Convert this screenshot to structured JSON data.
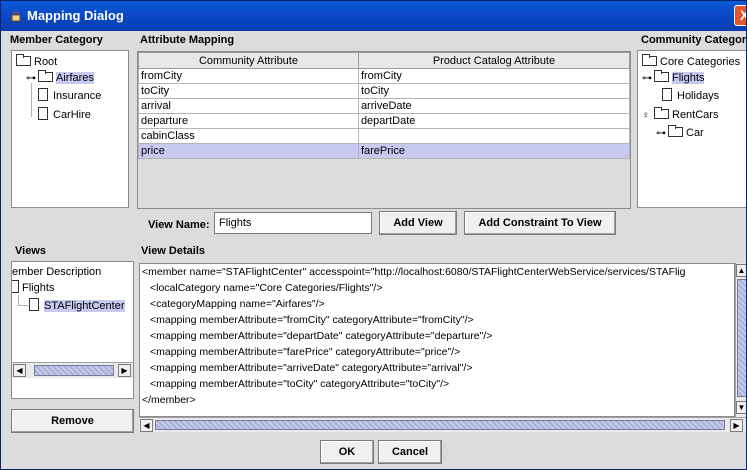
{
  "window": {
    "title": "Mapping Dialog",
    "close_label": "X"
  },
  "member_category": {
    "label": "Member Category",
    "tree": [
      {
        "label": "Root",
        "icon": "folder-icon"
      },
      {
        "label": "Airfares",
        "icon": "folder-icon",
        "selected": true
      },
      {
        "label": "Insurance",
        "icon": "document-icon"
      },
      {
        "label": "CarHire",
        "icon": "document-icon"
      }
    ]
  },
  "attribute_mapping": {
    "label": "Attribute Mapping",
    "columns": [
      "Community Attribute",
      "Product Catalog Attribute"
    ],
    "rows": [
      [
        "fromCity",
        "fromCity"
      ],
      [
        "toCity",
        "toCity"
      ],
      [
        "arrival",
        "arriveDate"
      ],
      [
        "departure",
        "departDate"
      ],
      [
        "cabinClass",
        ""
      ],
      [
        "price",
        "farePrice"
      ]
    ]
  },
  "community_category": {
    "label": "Community Category",
    "tree": [
      {
        "label": "Core Categories",
        "icon": "folder-icon"
      },
      {
        "label": "Flights",
        "icon": "folder-icon",
        "selected": true
      },
      {
        "label": "Holidays",
        "icon": "document-icon"
      },
      {
        "label": "RentCars",
        "icon": "folder-icon"
      },
      {
        "label": "Car",
        "icon": "folder-icon"
      }
    ]
  },
  "view_name": {
    "label": "View Name:",
    "value": "Flights"
  },
  "buttons": {
    "add_view": "Add View",
    "add_constraint": "Add Constraint To View",
    "remove": "Remove",
    "ok": "OK",
    "cancel": "Cancel"
  },
  "views": {
    "label": "Views",
    "tree": [
      {
        "label": "ember Description"
      },
      {
        "label": "Flights"
      },
      {
        "label": "STAFlightCenter",
        "selected": true
      }
    ]
  },
  "view_details": {
    "label": "View Details",
    "lines": [
      "<member name=\"STAFlightCenter\" accesspoint=\"http://localhost:6080/STAFlightCenterWebService/services/STAFlig",
      "<localCategory name=\"Core Categories/Flights\"/>",
      "<categoryMapping name=\"Airfares\"/>",
      "<mapping memberAttribute=\"fromCity\" categoryAttribute=\"fromCity\"/>",
      "<mapping memberAttribute=\"departDate\" categoryAttribute=\"departure\"/>",
      "<mapping memberAttribute=\"farePrice\" categoryAttribute=\"price\"/>",
      "<mapping memberAttribute=\"arriveDate\" categoryAttribute=\"arrival\"/>",
      "<mapping memberAttribute=\"toCity\" categoryAttribute=\"toCity\"/>",
      "</member>"
    ]
  },
  "colors": {
    "titlebar": "#0a46c4",
    "selection": "#c7c9f0",
    "close": "#e2572f"
  }
}
